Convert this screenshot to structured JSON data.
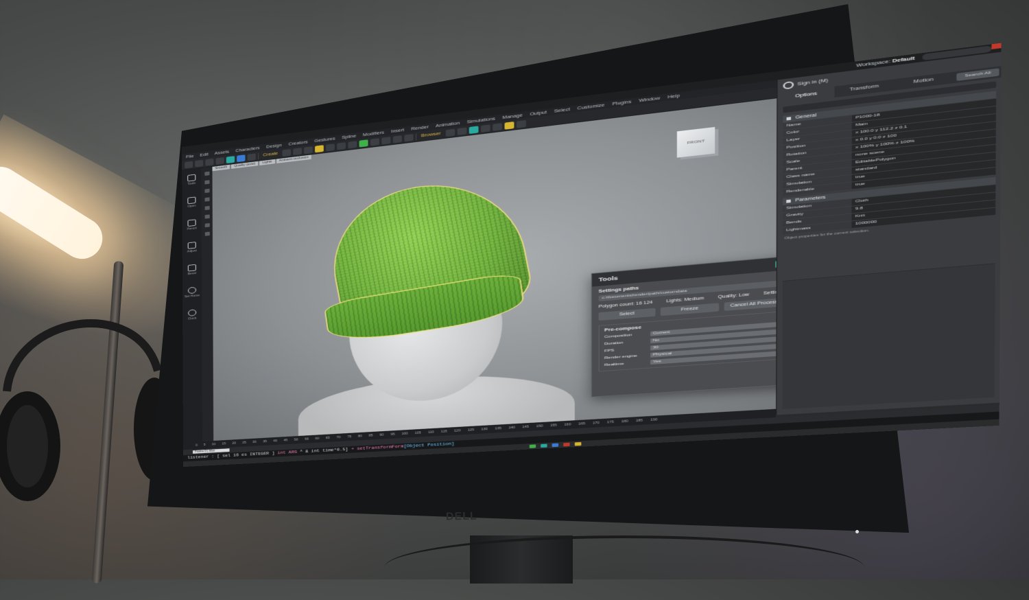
{
  "scene": {
    "monitor_brand": "DELL"
  },
  "app": {
    "workspace_label": "Workspace",
    "workspace_value": "Default",
    "sign_in": "Sign in (M)",
    "menu": [
      "File",
      "Edit",
      "Assets",
      "Characters",
      "Design",
      "Creators",
      "Gestures",
      "Spline",
      "Modifiers",
      "Insert",
      "Render",
      "Animation",
      "Simulations",
      "Manage",
      "Output",
      "Select",
      "Customize",
      "Plugins",
      "Window",
      "Help"
    ],
    "toolbar_create": "Create",
    "toolbar_browser": "Browser",
    "rail": [
      {
        "label": "Tools",
        "icon": "tools-icon"
      },
      {
        "label": "Open",
        "icon": "folder-icon"
      },
      {
        "label": "Pencil",
        "icon": "pencil-icon"
      },
      {
        "label": "Adjust",
        "icon": "sliders-icon"
      },
      {
        "label": "Bevel",
        "icon": "bevel-icon"
      },
      {
        "label": "Set Home",
        "icon": "home-icon"
      },
      {
        "label": "Clock",
        "icon": "clock-icon"
      }
    ],
    "viewport_tabs": [
      "Smooth",
      "Quality (auto)",
      "Lights",
      "Ambient occlusion"
    ],
    "viewcube_label": "FRONT",
    "dialog": {
      "title": "Tools",
      "settings_label": "Settings paths",
      "path": "c:/documents/render/path/customdata",
      "polygon_count": "Polygon count: 16 124",
      "lights": "Lights: Medium",
      "quality": "Quality: Low",
      "settings": "Settings",
      "btn_select": "Select",
      "btn_freeze": "Freeze",
      "btn_cancel": "Cancel All Process",
      "group_title": "Pre-compose",
      "fields": [
        {
          "label": "Composition",
          "value": "Current"
        },
        {
          "label": "Duration",
          "value": "No"
        },
        {
          "label": "FPS",
          "value": "30"
        },
        {
          "label": "Render engine",
          "value": "Physical"
        },
        {
          "label": "Realtime",
          "value": "Yes"
        }
      ]
    },
    "right_panel": {
      "tabs": [
        "Options",
        "Transform",
        "Motion"
      ],
      "more": "Search All",
      "general_title": "General",
      "general": [
        {
          "k": "Name",
          "v": "P1000-18"
        },
        {
          "k": "Color",
          "v": "Main"
        },
        {
          "k": "Layer",
          "v": "x 100.0    y 112.2    z 0.1"
        },
        {
          "k": "Position",
          "v": "x 0.0    y 0.0    z 100"
        },
        {
          "k": "Rotation",
          "v": "x 100%    y 100%    z 100%"
        },
        {
          "k": "Scale",
          "v": "none scene"
        },
        {
          "k": "Parent",
          "v": "EditablePolygon"
        },
        {
          "k": "Class name",
          "v": "standard"
        },
        {
          "k": "Simulation",
          "v": "true"
        },
        {
          "k": "Renderable",
          "v": "true"
        }
      ],
      "params_title": "Parameters",
      "params": [
        {
          "k": "Simulation",
          "v": "Cloth"
        },
        {
          "k": "Gravity",
          "v": "9.8"
        },
        {
          "k": "Bends",
          "v": "Knit"
        },
        {
          "k": "Lightmass",
          "v": "1000000"
        }
      ],
      "note": "Object properties for the current selection."
    },
    "timeline_ticks": [
      "0",
      "5",
      "10",
      "15",
      "20",
      "25",
      "30",
      "35",
      "40",
      "45",
      "50",
      "55",
      "60",
      "65",
      "70",
      "75",
      "80",
      "85",
      "90",
      "95",
      "100",
      "105",
      "110",
      "115",
      "120",
      "125",
      "130",
      "135",
      "140",
      "145",
      "150",
      "155",
      "160",
      "165",
      "170",
      "175",
      "180",
      "185",
      "190"
    ],
    "range_label": "Frame 0   |  Max",
    "status": {
      "a": "listener : [ sel 16 es INTEGER ] ",
      "b": "int ARG",
      "c": " ^ & int time*0.5] ",
      "d": "+ setTransformForm",
      "e": "[Object Position]"
    }
  }
}
